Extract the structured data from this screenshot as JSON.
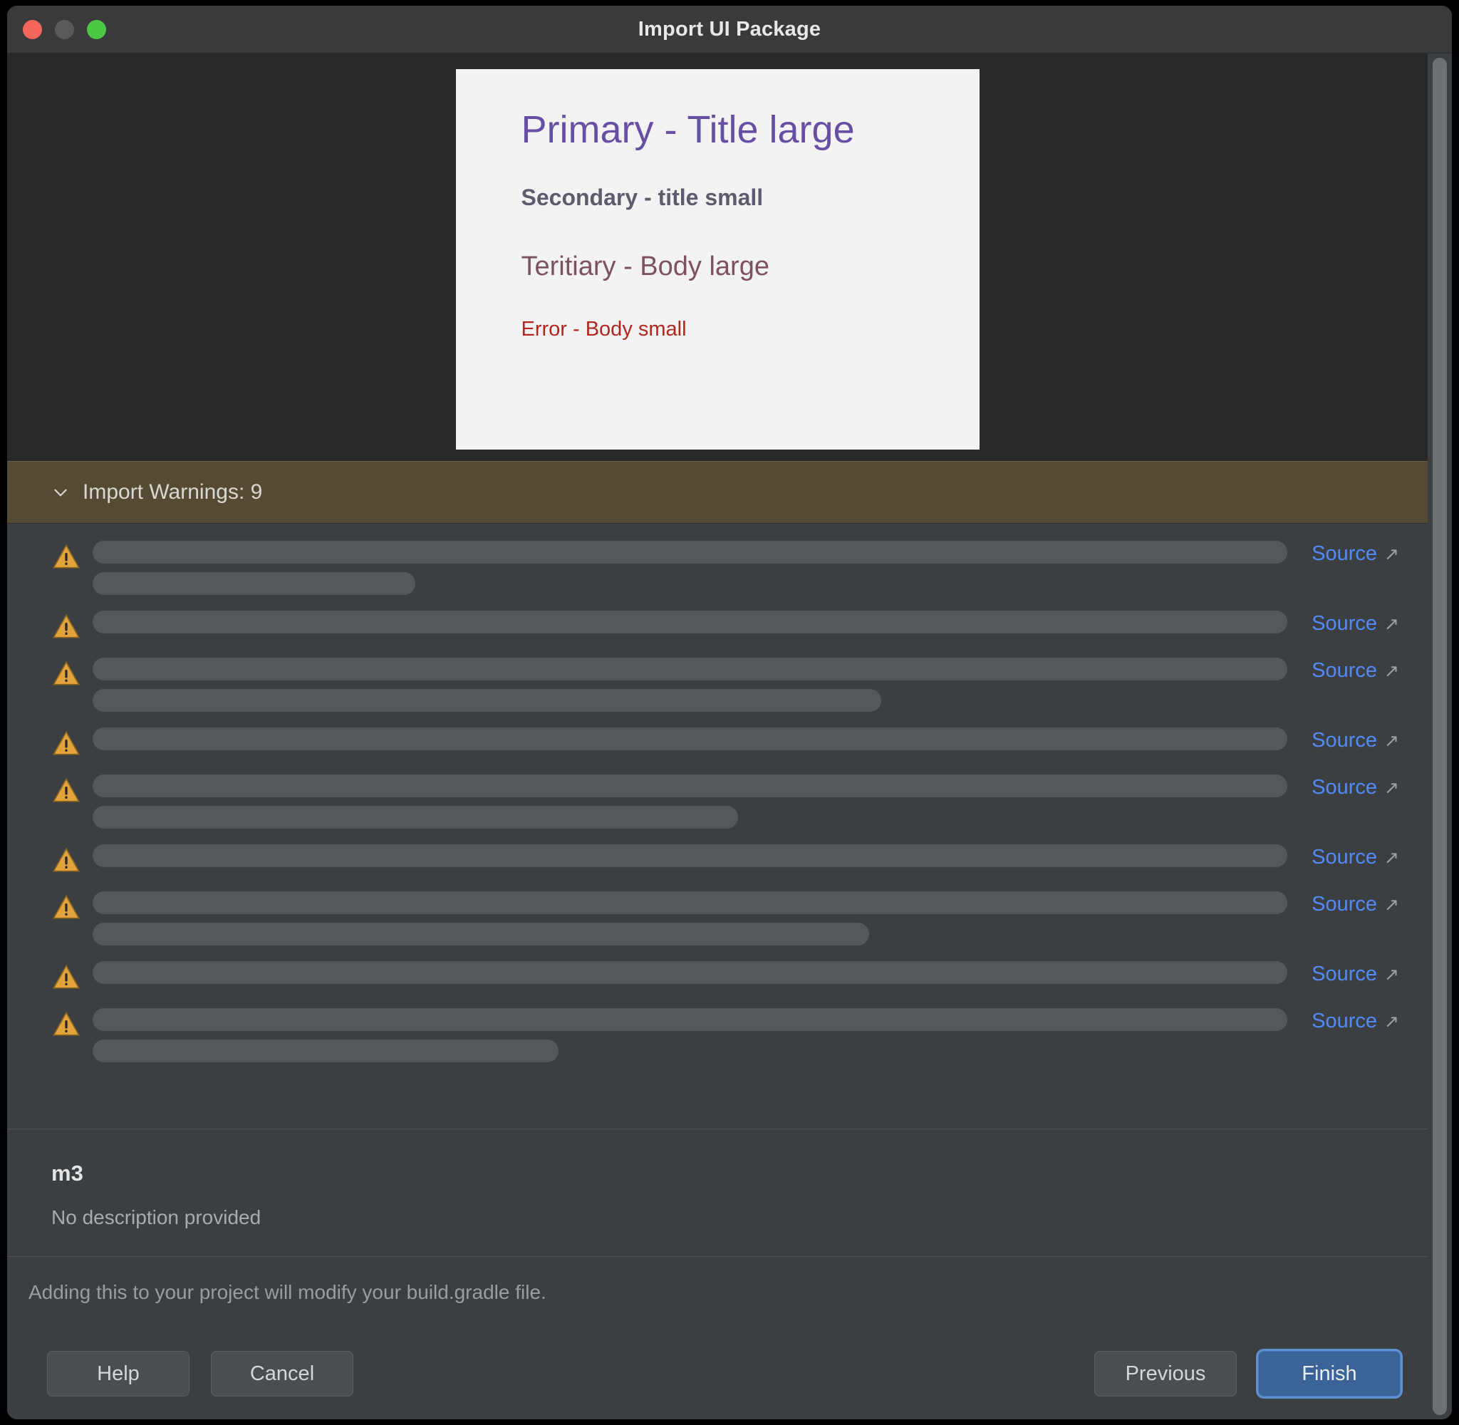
{
  "window": {
    "title": "Import UI Package",
    "traffic_lights": [
      {
        "name": "close",
        "color": "#F4655B"
      },
      {
        "name": "minimize",
        "color": "#5A5A5C"
      },
      {
        "name": "zoom",
        "color": "#4CC845"
      }
    ]
  },
  "preview": {
    "background": "#282828",
    "card_background": "#F4F3F4",
    "primary": {
      "text": "Primary - Title large",
      "color": "#6750A4"
    },
    "secondary": {
      "text": "Secondary - title small",
      "color": "#5F5A6E"
    },
    "tertiary": {
      "text": "Teritiary - Body large",
      "color": "#7D5260"
    },
    "error": {
      "text": "Error - Body small",
      "color": "#B3261E"
    }
  },
  "warnings_banner": {
    "label": "Import Warnings: 9",
    "count": 9,
    "expanded": true,
    "chevron_icon": "chevron-down-icon",
    "background": "#554B35"
  },
  "warnings": {
    "source_label": "Source",
    "external_link_glyph": "↗",
    "warning_icon": "warning-triangle-icon",
    "icon_color": "#E2A33C",
    "link_color": "#548AF7",
    "items": [
      {
        "lines": [
          100,
          27
        ],
        "has_source": true
      },
      {
        "lines": [
          100
        ],
        "has_source": true
      },
      {
        "lines": [
          100,
          66
        ],
        "has_source": true
      },
      {
        "lines": [
          100
        ],
        "has_source": true
      },
      {
        "lines": [
          100,
          54
        ],
        "has_source": true
      },
      {
        "lines": [
          100
        ],
        "has_source": true
      },
      {
        "lines": [
          100,
          65
        ],
        "has_source": true
      },
      {
        "lines": [
          100
        ],
        "has_source": true
      },
      {
        "lines": [
          100,
          39
        ],
        "has_source": true
      }
    ]
  },
  "description": {
    "title": "m3",
    "subtitle": "No description provided"
  },
  "note": {
    "text": "Adding this to your project will modify your build.gradle file."
  },
  "footer": {
    "help_label": "Help",
    "cancel_label": "Cancel",
    "previous_label": "Previous",
    "finish_label": "Finish",
    "primary_color": "#3C6397"
  },
  "scrollbar": {
    "thumb_color": "#6E7173"
  }
}
